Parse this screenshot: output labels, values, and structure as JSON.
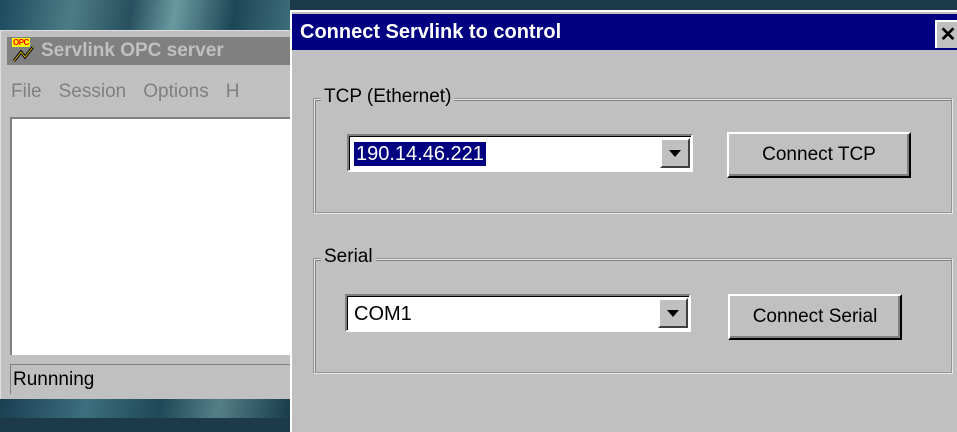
{
  "background_app": {
    "title": "Servlink OPC server",
    "icon_text": "OPC",
    "menu": [
      "File",
      "Session",
      "Options",
      "H"
    ],
    "status": "Runnning"
  },
  "dialog": {
    "title": "Connect Servlink to control",
    "close_label": "✕",
    "tcp_group": {
      "label": "TCP (Ethernet)",
      "address_value": "190.14.46.221",
      "connect_label": "Connect TCP"
    },
    "serial_group": {
      "label": "Serial",
      "port_value": "COM1",
      "connect_label": "Connect Serial"
    }
  },
  "colors": {
    "titlebar_active": "#000080",
    "titlebar_inactive": "#808080",
    "face": "#c0c0c0",
    "selection": "#000080"
  }
}
